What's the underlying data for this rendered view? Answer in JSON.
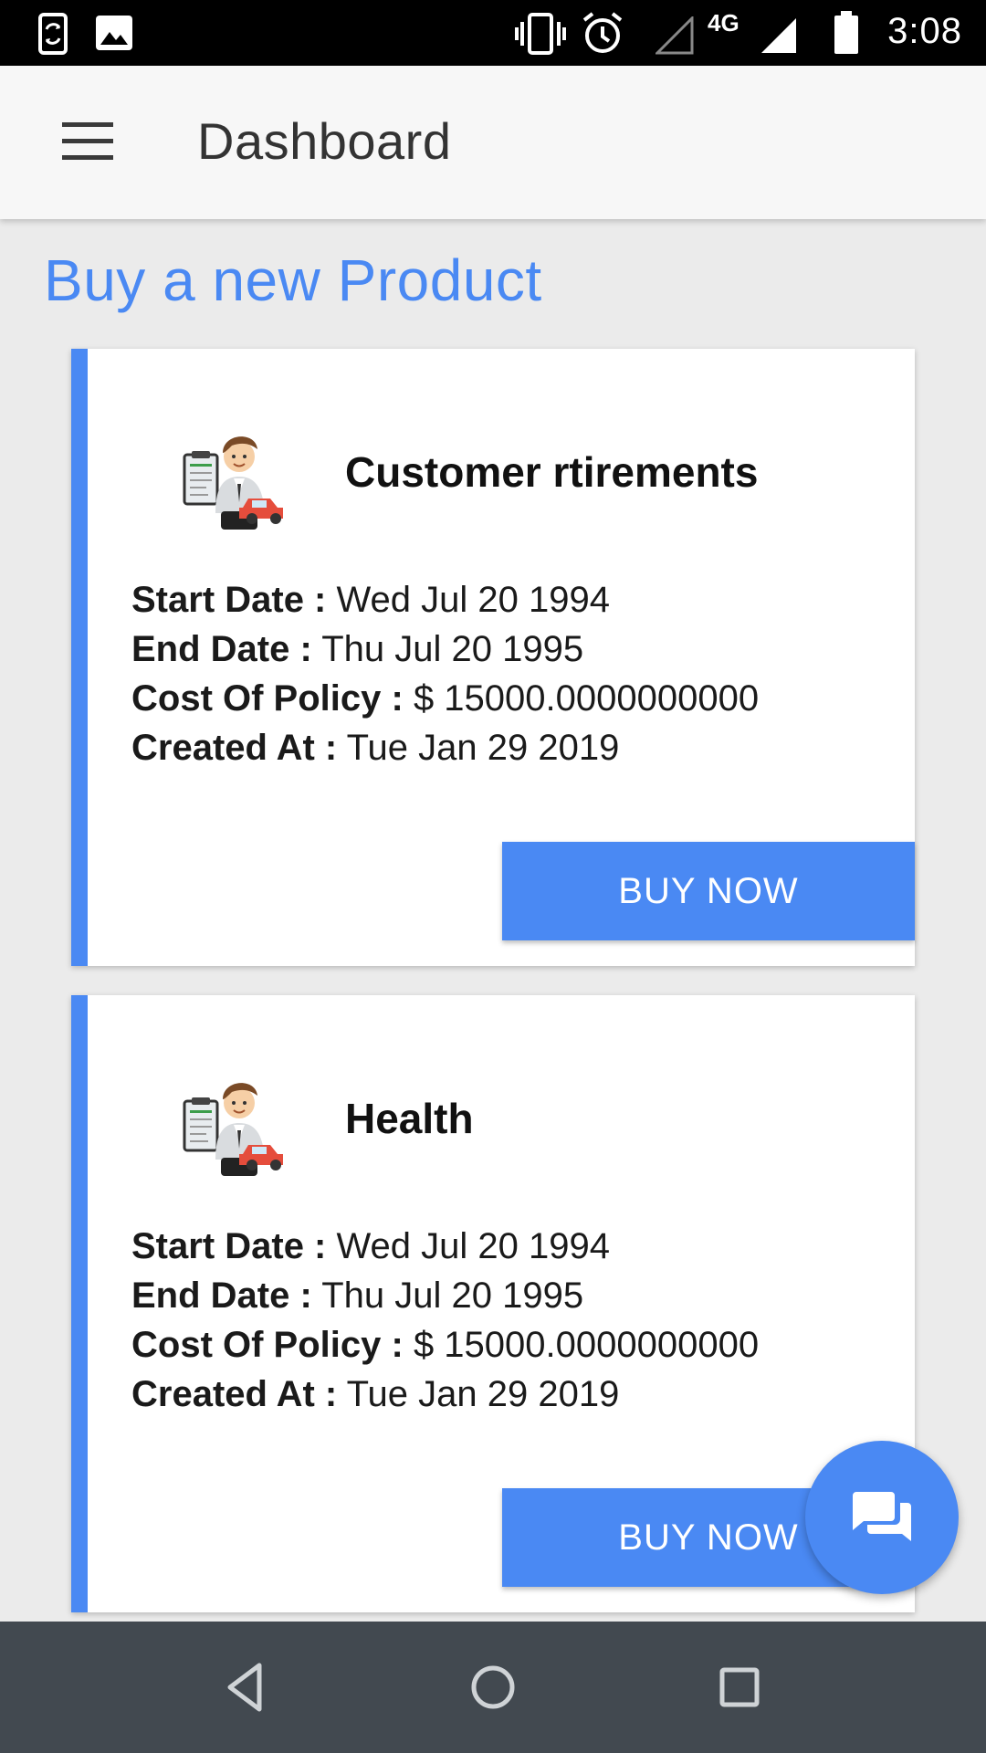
{
  "status_bar": {
    "time": "3:08",
    "network": "4G",
    "icons": [
      "screen-rotation-icon",
      "image-icon",
      "vibrate-icon",
      "alarm-icon",
      "no-signal-icon",
      "cell-signal-icon",
      "battery-icon"
    ]
  },
  "app_bar": {
    "title": "Dashboard",
    "menu_icon": "hamburger-menu-icon"
  },
  "section": {
    "heading": "Buy a new Product"
  },
  "products": [
    {
      "title": "Customer rtirements",
      "avatar_icon": "insurance-agent-icon",
      "start_date_label": "Start Date :",
      "start_date": "Wed Jul 20 1994",
      "end_date_label": "End Date :",
      "end_date": "Thu Jul 20 1995",
      "cost_label": "Cost Of Policy :",
      "cost": "$ 15000.0000000000",
      "created_label": "Created At :",
      "created": "Tue Jan 29 2019",
      "button_label": "BUY NOW"
    },
    {
      "title": "Health",
      "avatar_icon": "insurance-agent-icon",
      "start_date_label": "Start Date :",
      "start_date": "Wed Jul 20 1994",
      "end_date_label": "End Date :",
      "end_date": "Thu Jul 20 1995",
      "cost_label": "Cost Of Policy :",
      "cost": "$ 15000.0000000000",
      "created_label": "Created At :",
      "created": "Tue Jan 29 2019",
      "button_label": "BUY NOW"
    }
  ],
  "fab": {
    "icon": "chat-icon"
  },
  "nav_bar": {
    "icons": [
      "back-icon",
      "home-icon",
      "recents-icon"
    ]
  },
  "colors": {
    "accent": "#4a89f3",
    "status_bar": "#000000",
    "app_bar": "#f7f7f7",
    "background": "#ebebeb",
    "nav_bar": "#424950"
  }
}
